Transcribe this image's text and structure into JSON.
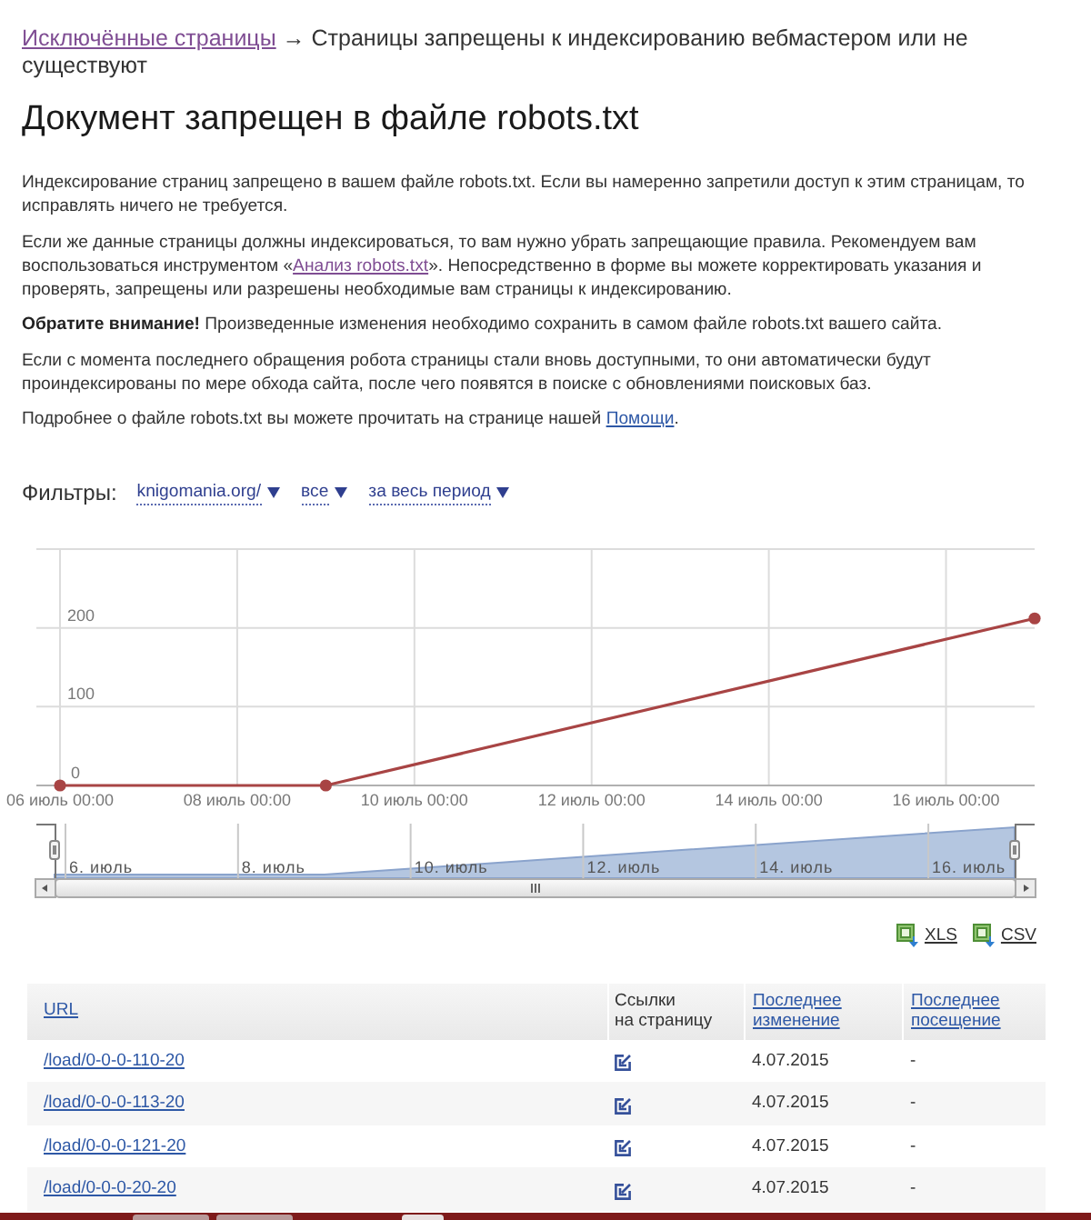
{
  "breadcrumb": {
    "link": {
      "text": "Исключённые страницы",
      "visited": true
    },
    "separator": "→",
    "current": "Страницы запрещены к индексированию вебмастером или не существуют"
  },
  "title": "Документ запрещен в файле robots.txt",
  "paragraphs": [
    {
      "parts": [
        {
          "kind": "text",
          "text": "Индексирование страниц запрещено в вашем файле robots.txt. Если вы намеренно запретили доступ к этим страницам, то исправлять ничего не требуется."
        }
      ]
    },
    {
      "parts": [
        {
          "kind": "text",
          "text": "Если же данные страницы должны индексироваться, то вам нужно убрать запрещающие правила. Рекомендуем вам воспользоваться инструментом «"
        },
        {
          "kind": "link",
          "text": "Анализ robots.txt",
          "visited": true
        },
        {
          "kind": "text",
          "text": "». Непосредственно в форме вы можете корректировать указания и проверять, запрещены или разрешены необходимые вам страницы к индексированию."
        }
      ]
    },
    {
      "parts": [
        {
          "kind": "text",
          "text": "**Обратите внимание!** Произведенные изменения необходимо сохранить в самом файле robots.txt вашего сайта."
        }
      ]
    },
    {
      "parts": [
        {
          "kind": "text",
          "text": "Если с момента последнего обращения робота страницы стали вновь доступными, то они автоматически будут проиндексированы по мере обхода сайта, после чего появятся в поиске с обновлениями поисковых баз."
        }
      ]
    },
    {
      "parts": [
        {
          "kind": "text",
          "text": "Подробнее о файле robots.txt вы можете прочитать на странице нашей "
        },
        {
          "kind": "link",
          "text": "Помощи",
          "visited": false
        },
        {
          "kind": "text",
          "text": "."
        }
      ]
    }
  ],
  "filters": {
    "label": "Фильтры:",
    "dropdowns": [
      {
        "value": "knigomania.org/"
      },
      {
        "value": "все"
      },
      {
        "value": "за весь период"
      }
    ]
  },
  "chart": {
    "chart_data": {
      "type": "line",
      "grid": true,
      "categories": [
        "06 июль 00:00",
        null,
        "08 июль 00:00",
        null,
        "10 июль 00:00",
        null,
        "12 июль 00:00",
        null,
        "14 июль 00:00",
        null,
        "16 июль 00:00",
        null
      ],
      "ylim": [
        0,
        300
      ],
      "yticks": [
        0,
        100,
        200
      ],
      "series": [
        {
          "color": "#a84444",
          "marker": true,
          "values": [
            0,
            null,
            null,
            0,
            null,
            null,
            null,
            null,
            null,
            null,
            null,
            212
          ]
        }
      ]
    }
  },
  "navigator": {
    "labels": [
      "6. июль",
      "8. июль",
      "10. июль",
      "12. июль",
      "14. июль",
      "16. июль"
    ]
  },
  "exports": [
    {
      "label": "XLS"
    },
    {
      "label": "CSV"
    }
  ],
  "table": {
    "columns": [
      {
        "label": "URL",
        "kind": "link"
      },
      {
        "label": "Ссылки\nна страницу",
        "kind": "text"
      },
      {
        "label": "Последнее\nизменение",
        "kind": "link"
      },
      {
        "label": "Последнее\nпосещение",
        "kind": "link"
      }
    ],
    "rows": [
      {
        "url": "/load/0-0-0-110-20",
        "last_modified": "4.07.2015",
        "last_visit": "-"
      },
      {
        "url": "/load/0-0-0-113-20",
        "last_modified": "4.07.2015",
        "last_visit": "-"
      },
      {
        "url": "/load/0-0-0-121-20",
        "last_modified": "4.07.2015",
        "last_visit": "-"
      },
      {
        "url": "/load/0-0-0-20-20",
        "last_modified": "4.07.2015",
        "last_visit": "-"
      }
    ]
  }
}
